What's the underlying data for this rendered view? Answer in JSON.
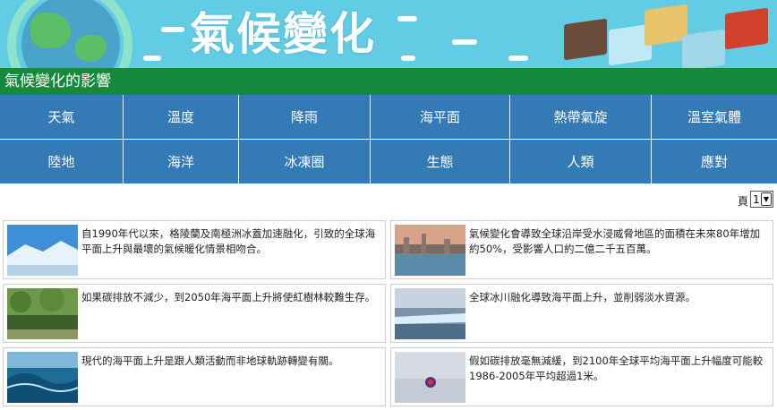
{
  "banner": {
    "title": "氣候變化"
  },
  "section": {
    "title": "氣候變化的影響"
  },
  "nav": {
    "items": [
      "天氣",
      "溫度",
      "降雨",
      "海平面",
      "熱帶氣旋",
      "溫室氣體",
      "陸地",
      "海洋",
      "冰凍圈",
      "生態",
      "人類",
      "應對"
    ]
  },
  "pager": {
    "label": "頁",
    "selected": "1"
  },
  "cards": [
    {
      "text": "自1990年代以來，格陵蘭及南極洲冰蓋加速融化，引致的全球海平面上升與最壞的氣候暖化情景相吻合。"
    },
    {
      "text": "氣候變化會導致全球沿岸受水浸威脅地區的面積在未來80年增加約50%，受影響人口約二億二千五百萬。"
    },
    {
      "text": "如果碳排放不減少，到2050年海平面上升將使紅樹林較難生存。"
    },
    {
      "text": "全球冰川融化導致海平面上升，並削弱淡水資源。"
    },
    {
      "text": "現代的海平面上升是跟人類活動而非地球軌跡轉變有關。"
    },
    {
      "text": "假如碳排放毫無減緩，到2100年全球平均海平面上升幅度可能較1986-2005年平均超過1米。"
    }
  ]
}
